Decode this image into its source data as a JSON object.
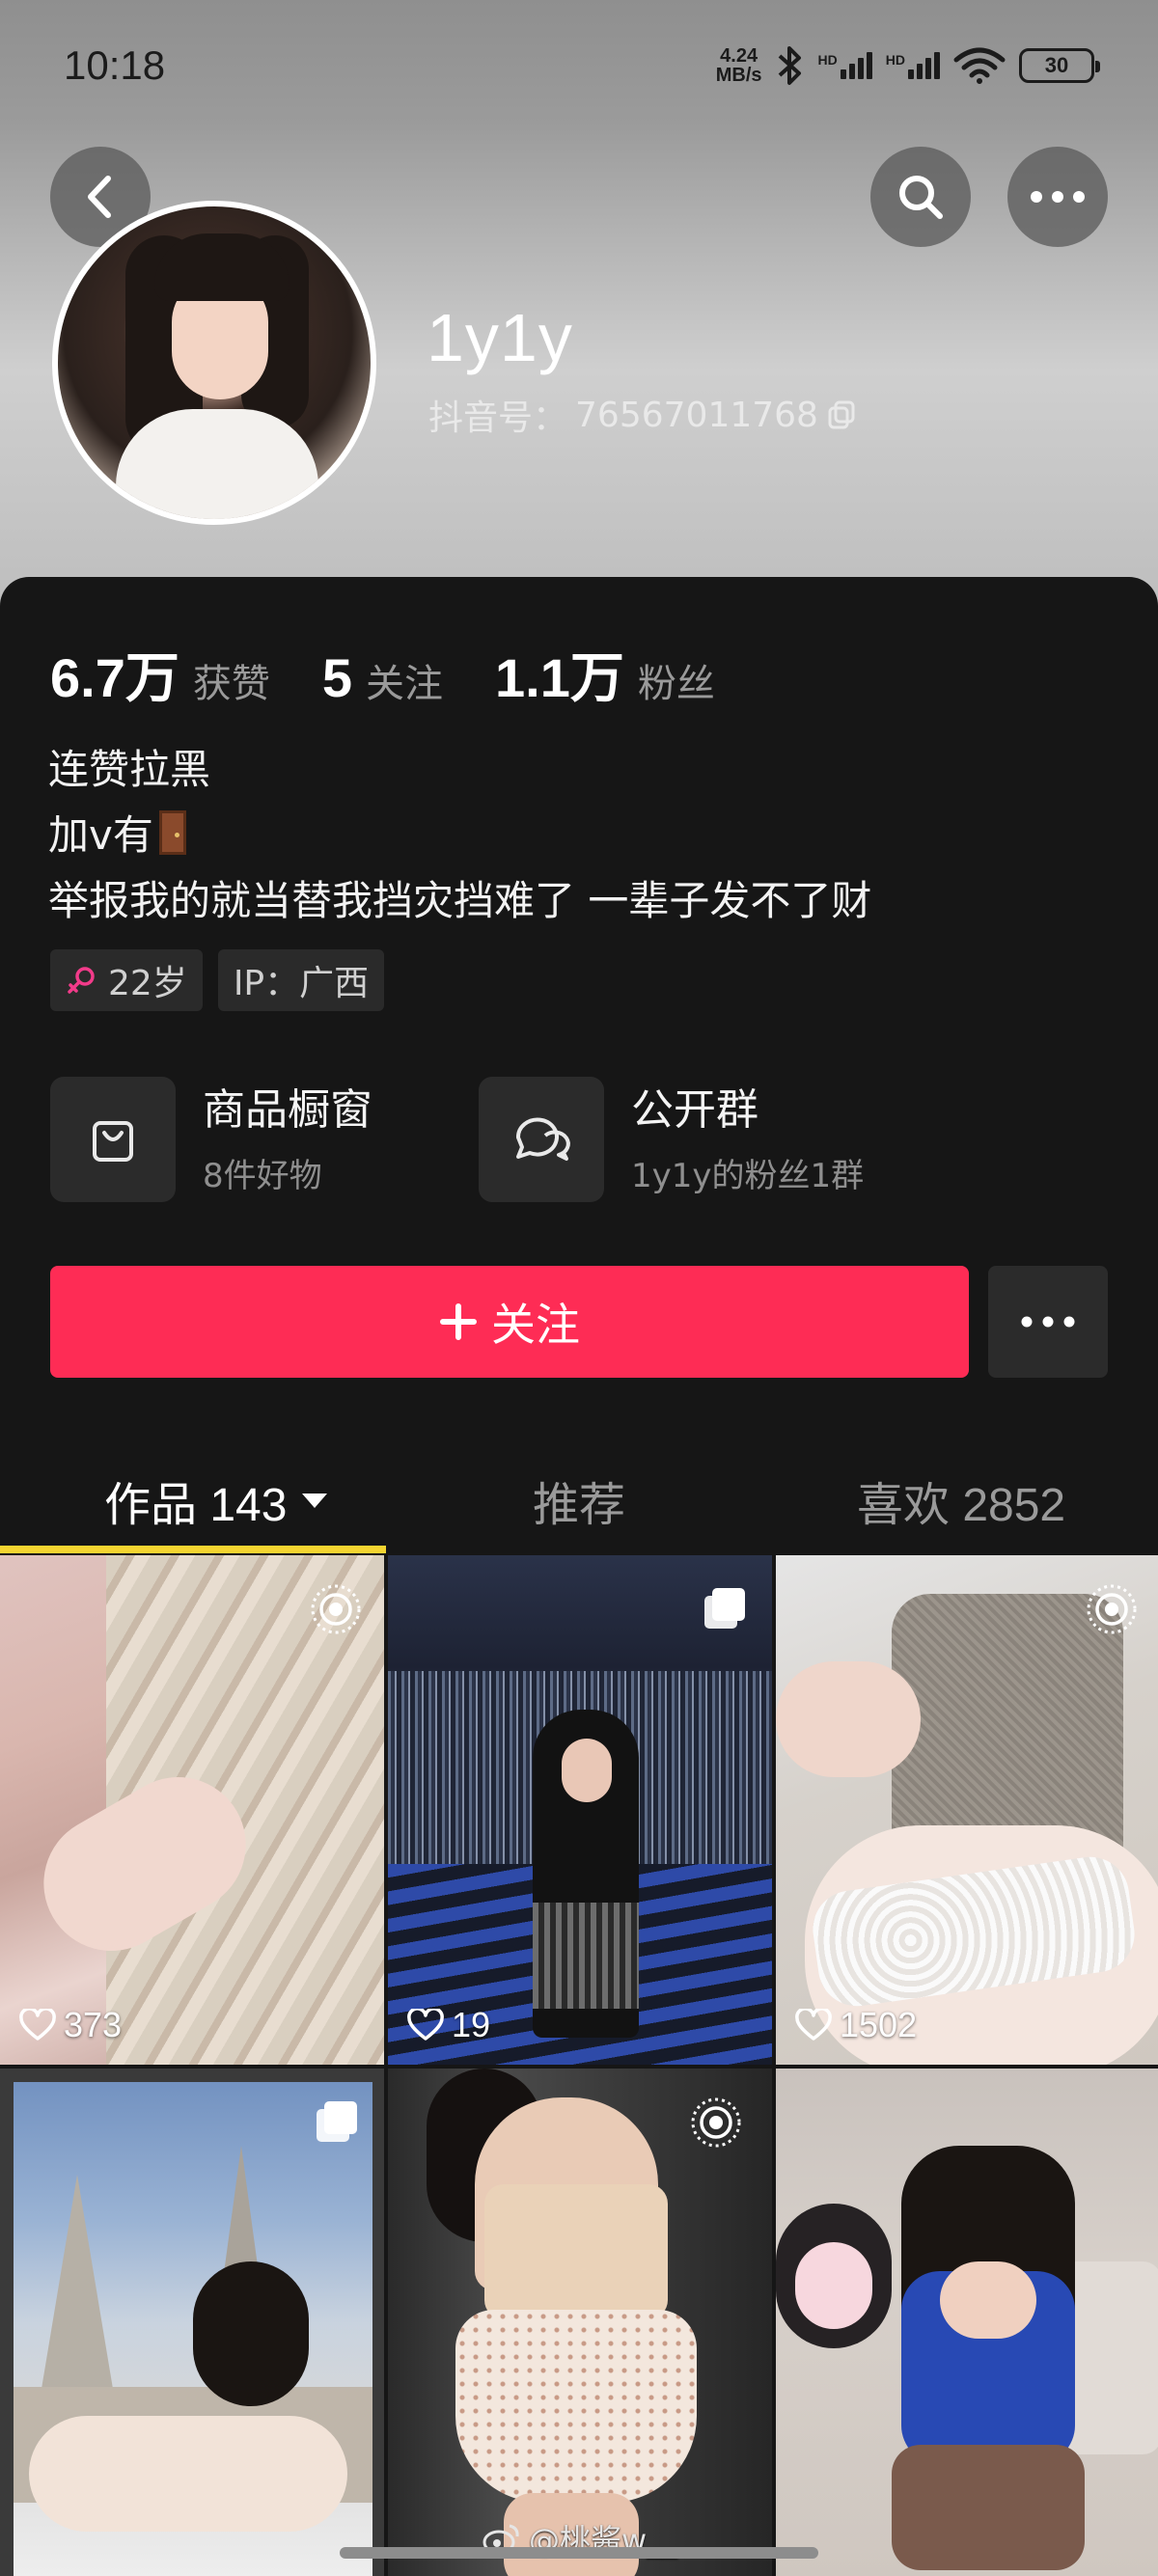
{
  "status_bar": {
    "time": "10:18",
    "net_speed_value": "4.24",
    "net_speed_unit": "MB/s",
    "hd1": "HD",
    "hd2": "HD",
    "battery": "30"
  },
  "profile": {
    "username": "1y1y",
    "douyin_id_label": "抖音号：",
    "douyin_id": "76567011768"
  },
  "stats": [
    {
      "num": "6.7万",
      "label": "获赞"
    },
    {
      "num": "5",
      "label": "关注"
    },
    {
      "num": "1.1万",
      "label": "粉丝"
    }
  ],
  "bio": {
    "line1": "连赞拉黑",
    "line2": "加v有",
    "line3": "举报我的就当替我挡灾挡难了  一辈子发不了财"
  },
  "tags": {
    "age": "22岁",
    "ip": "IP：广西"
  },
  "cards": {
    "shop_title": "商品橱窗",
    "shop_sub": "8件好物",
    "group_title": "公开群",
    "group_sub": "1y1y的粉丝1群"
  },
  "follow_button": "关注",
  "tabs": {
    "works": "作品 143",
    "recommend": "推荐",
    "likes": "喜欢 2852"
  },
  "videos": [
    {
      "likes": "373",
      "badge": "live-icon"
    },
    {
      "likes": "19",
      "badge": "multi-image-icon"
    },
    {
      "likes": "1502",
      "badge": "live-icon"
    },
    {
      "likes": "",
      "badge": "multi-image-icon"
    },
    {
      "likes": "",
      "badge": "live-icon"
    },
    {
      "likes": "",
      "badge": ""
    }
  ],
  "watermark": "@桃酱w__",
  "colors": {
    "accent": "#fe2c55",
    "tab_indicator": "#f5d531",
    "panel_bg": "#161616"
  }
}
